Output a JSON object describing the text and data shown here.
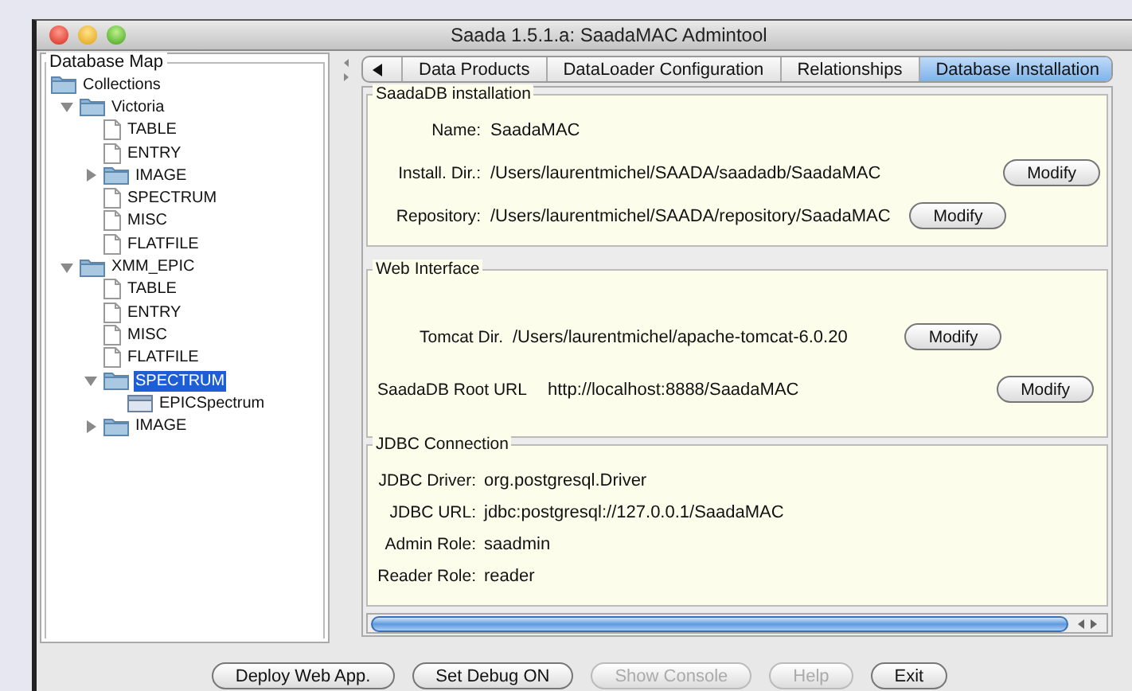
{
  "window": {
    "title": "Saada 1.5.1.a: SaadaMAC Admintool"
  },
  "sidebar": {
    "title": "Database Map",
    "tree": [
      {
        "label": "Collections",
        "kind": "folder",
        "children": [
          {
            "label": "Victoria",
            "kind": "folder",
            "expanded": true,
            "selected": false,
            "children": [
              {
                "label": "TABLE",
                "kind": "file",
                "selected": false
              },
              {
                "label": "ENTRY",
                "kind": "file",
                "selected": false
              },
              {
                "label": "IMAGE",
                "kind": "folder",
                "expanded": false,
                "selected": false
              },
              {
                "label": "SPECTRUM",
                "kind": "file",
                "selected": false
              },
              {
                "label": "MISC",
                "kind": "file",
                "selected": false
              },
              {
                "label": "FLATFILE",
                "kind": "file",
                "selected": false
              }
            ]
          },
          {
            "label": "XMM_EPIC",
            "kind": "folder",
            "expanded": true,
            "selected": false,
            "children": [
              {
                "label": "TABLE",
                "kind": "file",
                "selected": false
              },
              {
                "label": "ENTRY",
                "kind": "file",
                "selected": false
              },
              {
                "label": "MISC",
                "kind": "file",
                "selected": false
              },
              {
                "label": "FLATFILE",
                "kind": "file",
                "selected": false
              },
              {
                "label": "SPECTRUM",
                "kind": "folder",
                "expanded": true,
                "selected": true,
                "children": [
                  {
                    "label": "EPICSpectrum",
                    "kind": "class",
                    "selected": false
                  }
                ]
              },
              {
                "label": "IMAGE",
                "kind": "folder",
                "expanded": false,
                "selected": false
              }
            ]
          }
        ]
      }
    ]
  },
  "tabs": [
    {
      "label": "Data Products",
      "selected": false
    },
    {
      "label": "DataLoader Configuration",
      "selected": false
    },
    {
      "label": "Relationships",
      "selected": false
    },
    {
      "label": "Database Installation",
      "selected": true
    }
  ],
  "sections": [
    {
      "title": "SaadaDB installation",
      "rows": [
        {
          "label": "Name:",
          "value": "SaadaMAC"
        },
        {
          "label": "Install. Dir.:",
          "value": "/Users/laurentmichel/SAADA/saadadb/SaadaMAC",
          "button": "Modify"
        },
        {
          "label": "Repository:",
          "value": "/Users/laurentmichel/SAADA/repository/SaadaMAC",
          "button": "Modify"
        }
      ]
    },
    {
      "title": "Web Interface",
      "rows": [
        {
          "label": "Tomcat Dir.",
          "value": "/Users/laurentmichel/apache-tomcat-6.0.20",
          "button": "Modify"
        },
        {
          "label": "SaadaDB Root URL",
          "value": "http://localhost:8888/SaadaMAC",
          "button": "Modify"
        }
      ]
    },
    {
      "title": "JDBC Connection",
      "rows": [
        {
          "label": "JDBC Driver:",
          "value": "org.postgresql.Driver"
        },
        {
          "label": "JDBC URL:",
          "value": "jdbc:postgresql://127.0.0.1/SaadaMAC"
        },
        {
          "label": "Admin Role:",
          "value": "saadmin"
        },
        {
          "label": "Reader Role:",
          "value": "reader"
        }
      ]
    }
  ],
  "buttons": [
    {
      "label": "Deploy Web App.",
      "disabled": false
    },
    {
      "label": "Set Debug ON",
      "disabled": false
    },
    {
      "label": "Show Console",
      "disabled": true
    },
    {
      "label": "Help",
      "disabled": true
    },
    {
      "label": "Exit",
      "disabled": false
    }
  ]
}
